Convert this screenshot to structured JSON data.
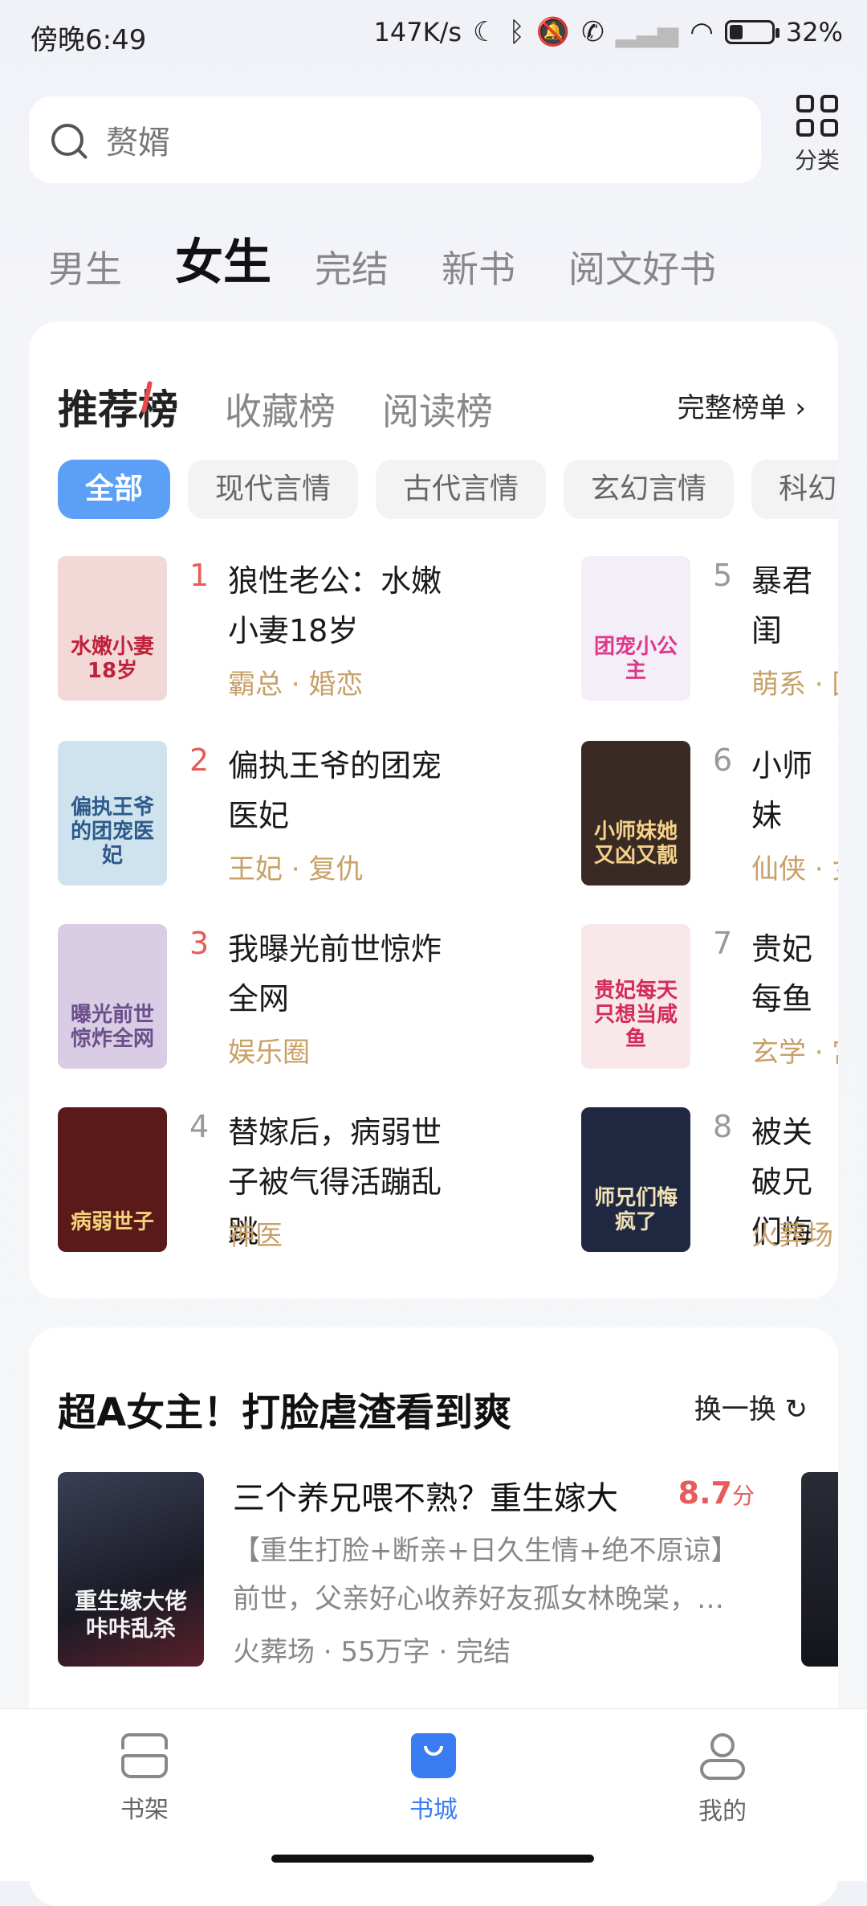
{
  "status": {
    "time": "傍晚6:49",
    "net_speed": "147K/s",
    "battery": "32%",
    "battery_level": 0.32
  },
  "search": {
    "placeholder": "赘婿"
  },
  "category_button": {
    "label": "分类"
  },
  "channel_tabs": [
    "男生",
    "女生",
    "完结",
    "新书",
    "阅文好书"
  ],
  "ranking": {
    "tabs": [
      "推荐榜",
      "收藏榜",
      "阅读榜"
    ],
    "full_list": "完整榜单 ›",
    "filters": [
      "全部",
      "现代言情",
      "古代言情",
      "玄幻言情",
      "科幻"
    ],
    "books": [
      {
        "rank": "1",
        "title": "狼性老公：水嫩小妻18岁",
        "tags": "霸总 · 婚恋",
        "cover_text": "水嫩小妻18岁",
        "cover_bg": "#f3d8d8",
        "cover_fg": "#c0213a"
      },
      {
        "rank": "2",
        "title": "偏执王爷的团宠医妃",
        "tags": "王妃 · 复仇",
        "cover_text": "偏执王爷的团宠医妃",
        "cover_bg": "#cfe3ef",
        "cover_fg": "#2d5a8a"
      },
      {
        "rank": "3",
        "title": "我曝光前世惊炸全网",
        "tags": "娱乐圈",
        "cover_text": "曝光前世惊炸全网",
        "cover_bg": "#d8cde4",
        "cover_fg": "#6b4f8a"
      },
      {
        "rank": "4",
        "title": "替嫁后，病弱世子被气得活蹦乱跳",
        "tags": "神医",
        "cover_text": "病弱世子",
        "cover_bg": "#5a1a1a",
        "cover_fg": "#f2d37a"
      },
      {
        "rank": "5",
        "title": "暴君闺",
        "tags": "萌系 · 团",
        "cover_text": "团宠小公主",
        "cover_bg": "#f4eef8",
        "cover_fg": "#e0378a"
      },
      {
        "rank": "6",
        "title": "小师妹",
        "tags": "仙侠 · 女",
        "cover_text": "小师妹她又凶又靓",
        "cover_bg": "#3a2a24",
        "cover_fg": "#f5d28a"
      },
      {
        "rank": "7",
        "title": "贵妃每鱼",
        "tags": "玄学 · 宫",
        "cover_text": "贵妃每天只想当咸鱼",
        "cover_bg": "#f8e8ea",
        "cover_fg": "#d42a5a"
      },
      {
        "rank": "8",
        "title": "被关破兄们悔",
        "tags": "火葬场",
        "cover_text": "师兄们悔疯了",
        "cover_bg": "#1f2840",
        "cover_fg": "#f0e2b8"
      }
    ]
  },
  "recommend": {
    "title": "超A女主！打脸虐渣看到爽",
    "refresh": "换一换 ↻",
    "book": {
      "title": "三个养兄喂不熟？重生嫁大",
      "score": "8.7",
      "score_unit": "分",
      "intro1": "【重生打脸+断亲+日久生情+绝不原谅】",
      "intro2": "前世，父亲好心收养好友孤女林晚棠，…",
      "meta": "火葬场 · 55万字 · 完结",
      "cover_text": "重生嫁大佬咔咔乱杀"
    }
  },
  "bottom_nav": [
    "书架",
    "书城",
    "我的"
  ],
  "colors": {
    "accent": "#3a7cf2",
    "rank_top": "#e85b5b",
    "tag": "#c8a068",
    "chip_active": "#5b9ff6"
  }
}
